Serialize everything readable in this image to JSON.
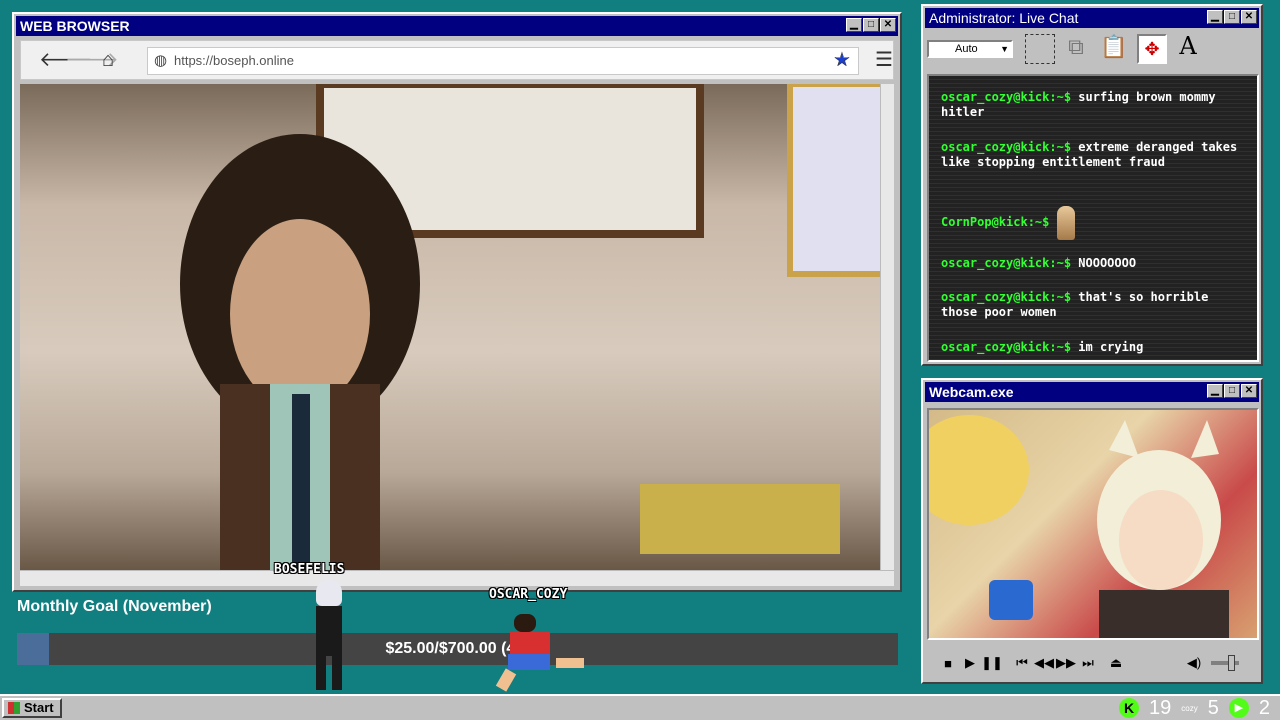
{
  "browser": {
    "title": "WEB BROWSER",
    "url": "https://boseph.online",
    "icons": {
      "back": "back-arrow-icon",
      "forward": "forward-arrow-icon",
      "home": "home-icon",
      "globe": "globe-icon",
      "star_filled": "star-filled-icon",
      "star": "star-outline-icon",
      "menu": "hamburger-menu-icon"
    }
  },
  "chat": {
    "title": "Administrator: Live Chat",
    "font_select": "Auto",
    "messages": [
      {
        "user": "oscar_cozy@kick:~$",
        "text": "surfing brown mommy hitler"
      },
      {
        "user": "oscar_cozy@kick:~$",
        "text": "extreme deranged takes like stopping entitlement fraud"
      },
      {
        "user": "CornPop@kick:~$",
        "text": ""
      },
      {
        "user": "oscar_cozy@kick:~$",
        "text": "NOOOOOOO"
      },
      {
        "user": "oscar_cozy@kick:~$",
        "text": "that's so horrible those poor women"
      },
      {
        "user": "oscar_cozy@kick:~$",
        "text": "im crying"
      }
    ]
  },
  "webcam": {
    "title": "Webcam.exe"
  },
  "goal": {
    "title": "Monthly Goal (November)",
    "text": "$25.00/$700.00 (4%",
    "progress_fraction": 0.036
  },
  "sprites": {
    "left_name": "BOSEFELIS",
    "right_name": "OSCAR_COZY"
  },
  "taskbar": {
    "start_label": "Start",
    "tray_1": "19",
    "tray_2": "5",
    "tray_3": "2",
    "tray_small_label": "cozy"
  },
  "colors": {
    "titlebar": "#000080",
    "desktop": "#117e80",
    "chat_user": "#33ff33",
    "goal_fill": "#4a6d99"
  }
}
